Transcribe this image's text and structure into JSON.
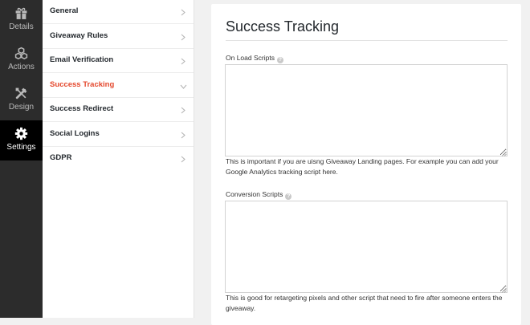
{
  "rail": {
    "items": [
      {
        "label": "Details",
        "icon": "gift-icon"
      },
      {
        "label": "Actions",
        "icon": "cubes-icon"
      },
      {
        "label": "Design",
        "icon": "tools-icon"
      },
      {
        "label": "Settings",
        "icon": "gear-icon",
        "active": true
      }
    ]
  },
  "nav": {
    "items": [
      {
        "label": "General"
      },
      {
        "label": "Giveaway Rules"
      },
      {
        "label": "Email Verification"
      },
      {
        "label": "Success Tracking",
        "active": true
      },
      {
        "label": "Success Redirect"
      },
      {
        "label": "Social Logins"
      },
      {
        "label": "GDPR"
      }
    ]
  },
  "main": {
    "title": "Success Tracking",
    "onload": {
      "label": "On Load Scripts",
      "value": "",
      "description": "This is important if you are uisng Giveaway Landing pages. For example you can add your Google Analytics tracking script here."
    },
    "conversion": {
      "label": "Conversion Scripts",
      "value": "",
      "description": "This is good for retargeting pixels and other script that need to fire after someone enters the giveaway."
    }
  },
  "colors": {
    "accent": "#e4472c",
    "rail_bg": "#2c2c2c",
    "rail_active_bg": "#000000"
  }
}
